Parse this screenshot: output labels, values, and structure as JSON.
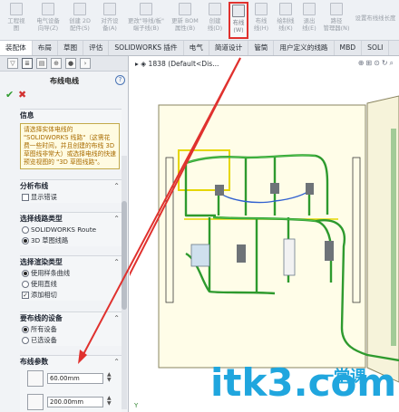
{
  "ribbon": {
    "buttons": [
      {
        "label": "工程视\n图",
        "name": "engineering-view"
      },
      {
        "label": "电气设备\n向导(Z)",
        "name": "electrical-device-wizard"
      },
      {
        "label": "创建 2D\n配件(S)",
        "name": "create-2d-part"
      },
      {
        "label": "对齐设\n备(A)",
        "name": "align-equipment"
      },
      {
        "label": "更改\"导线/板\"\n端子线(B)",
        "name": "change-wire"
      },
      {
        "label": "更新 BOM\n属性(B)",
        "name": "update-bom"
      },
      {
        "label": "创建\n线(D)",
        "name": "create-line"
      },
      {
        "label": "布线\n(W)",
        "name": "route-wire"
      },
      {
        "label": "布线\n线(H)",
        "name": "route-line"
      },
      {
        "label": "绘制线\n线(K)",
        "name": "draw-line"
      },
      {
        "label": "退出\n线(E)",
        "name": "exit"
      },
      {
        "label": "路径\n管理器(N)",
        "name": "path-manager"
      },
      {
        "label": "设置布线线长度",
        "name": "set-length"
      }
    ]
  },
  "tabs": [
    "装配体",
    "布局",
    "草图",
    "评估",
    "SOLIDWORKS 插件",
    "电气",
    "简道设计",
    "管筒",
    "用户定义的线路",
    "MBD",
    "SOLI"
  ],
  "active_tab_index": 0,
  "panel": {
    "title": "布线电线",
    "help": "?",
    "ok": "✔",
    "cancel": "✖",
    "info": {
      "heading": "信息",
      "message": "请选择实体电线的 \"SOLIDWORKS 线路\"（这需花费一些时间，并且创建的布线 3D 草图线非常大）或选择电线的快速预览视图的 \"3D 草图线路\"。"
    },
    "analysis": {
      "heading": "分析布线",
      "show_errors": "显示错误",
      "show_errors_checked": false
    },
    "route_type": {
      "heading": "选择线路类型",
      "options": [
        "SOLIDWORKS Route",
        "3D 草图线路"
      ],
      "selected": 1
    },
    "render_type": {
      "heading": "选择渲染类型",
      "options": [
        "使用样条曲线",
        "使用直线"
      ],
      "selected": 0,
      "add_tangent": "添加相切",
      "add_tangent_checked": true
    },
    "devices": {
      "heading": "要布线的设备",
      "options": [
        "所有设备",
        "已选设备"
      ],
      "selected": 0
    },
    "params": {
      "heading": "布线参数",
      "values": [
        "60.00mm",
        "200.00mm"
      ]
    }
  },
  "viewport": {
    "doc_title": "1838 (Default<Dis..."
  },
  "watermark": {
    "text": "itk3.com",
    "cn": "一堂课"
  },
  "colors": {
    "highlight_red": "#e0312e",
    "wire_green": "#2e9a2e",
    "watermark_blue": "#20a6de",
    "panel_yellow": "#fffde8"
  }
}
